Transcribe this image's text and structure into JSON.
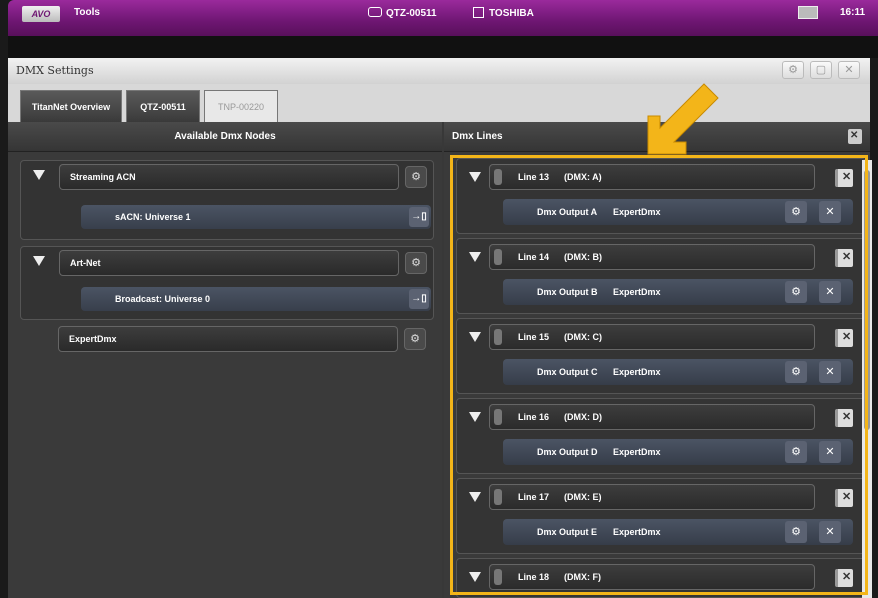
{
  "topbar": {
    "logo": "AVO",
    "tools_label": "Tools",
    "console_id": "QTZ-00511",
    "computer_name": "TOSHIBA",
    "time": "16:11"
  },
  "window": {
    "title": "DMX Settings",
    "btn_settings": "⚙",
    "btn_restore": "▢",
    "btn_close": "✕"
  },
  "tabs": [
    {
      "label": "TitanNet Overview"
    },
    {
      "label": "QTZ-00511"
    },
    {
      "label": "TNP-00220"
    }
  ],
  "left_panel": {
    "header": "Available Dmx Nodes",
    "groups": [
      {
        "name": "Streaming ACN",
        "universe": "sACN: Universe 1"
      },
      {
        "name": "Art-Net",
        "universe": "Broadcast: Universe 0"
      },
      {
        "name": "ExpertDmx"
      }
    ]
  },
  "right_panel": {
    "header": "Dmx Lines",
    "lines": [
      {
        "name": "Line 13",
        "dmx": "(DMX: A)",
        "output": "Dmx Output A",
        "driver": "ExpertDmx"
      },
      {
        "name": "Line 14",
        "dmx": "(DMX: B)",
        "output": "Dmx Output B",
        "driver": "ExpertDmx"
      },
      {
        "name": "Line 15",
        "dmx": "(DMX: C)",
        "output": "Dmx Output C",
        "driver": "ExpertDmx"
      },
      {
        "name": "Line 16",
        "dmx": "(DMX: D)",
        "output": "Dmx Output D",
        "driver": "ExpertDmx"
      },
      {
        "name": "Line 17",
        "dmx": "(DMX: E)",
        "output": "Dmx Output E",
        "driver": "ExpertDmx"
      },
      {
        "name": "Line 18",
        "dmx": "(DMX: F)"
      }
    ]
  },
  "colors": {
    "accent_topbar": "#6e1672",
    "highlight": "#f3b519",
    "universe_bg": "#4b5464"
  },
  "icons": {
    "gear": "⚙",
    "patch": "→▯",
    "close": "✕"
  }
}
